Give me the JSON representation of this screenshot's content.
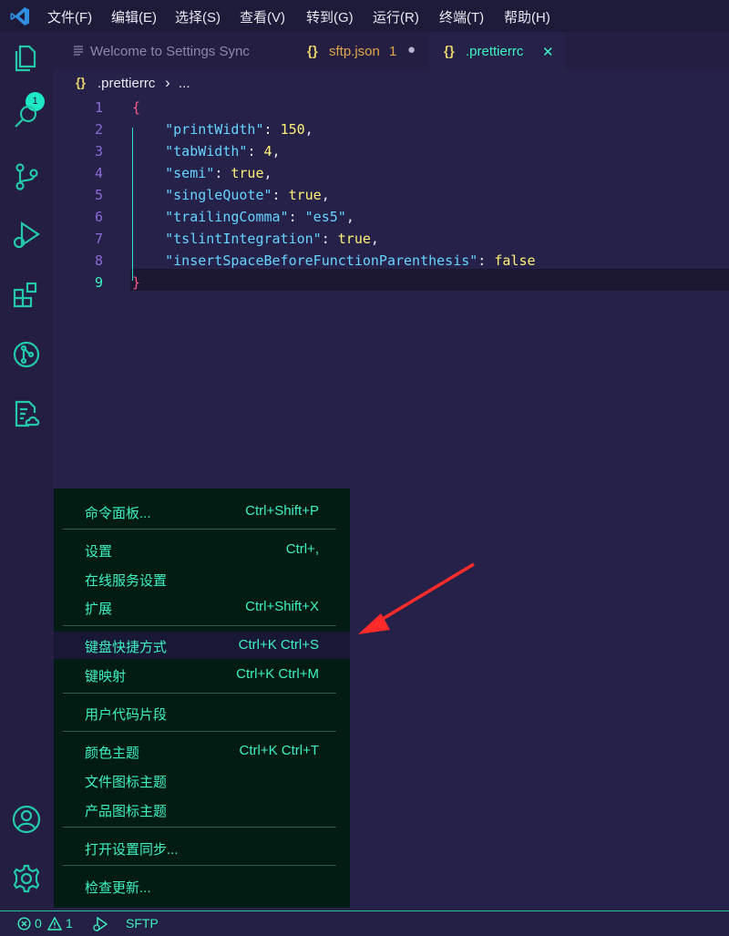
{
  "menubar": [
    "文件(F)",
    "编辑(E)",
    "选择(S)",
    "查看(V)",
    "转到(G)",
    "运行(R)",
    "终端(T)",
    "帮助(H)"
  ],
  "activity_bar": {
    "items": [
      "files-icon",
      "search-icon",
      "source-control-icon",
      "run-debug-icon",
      "extensions-icon",
      "git-graph-icon",
      "settings-sync-icon"
    ],
    "badge": "1",
    "bottom": [
      "account-icon",
      "manage-gear-icon"
    ]
  },
  "tabs": [
    {
      "label": "Welcome to Settings Sync",
      "icon": "preview-icon"
    },
    {
      "label": "sftp.json",
      "icon": "{}",
      "problems": "1",
      "modified": "●"
    },
    {
      "label": ".prettierrc",
      "icon": "{}",
      "close": "✕",
      "active": true
    }
  ],
  "breadcrumb": {
    "icon": "{}",
    "file": ".prettierrc",
    "sep": "›",
    "more": "..."
  },
  "editor": {
    "lines": [
      {
        "num": "1",
        "text": "{"
      },
      {
        "num": "2",
        "key": "\"printWidth\"",
        "value": "150",
        "vtype": "n",
        "comma": ","
      },
      {
        "num": "3",
        "key": "\"tabWidth\"",
        "value": "4",
        "vtype": "n",
        "comma": ","
      },
      {
        "num": "4",
        "key": "\"semi\"",
        "value": "true",
        "vtype": "n",
        "comma": ","
      },
      {
        "num": "5",
        "key": "\"singleQuote\"",
        "value": "true",
        "vtype": "n",
        "comma": ","
      },
      {
        "num": "6",
        "key": "\"trailingComma\"",
        "value": "\"es5\"",
        "vtype": "s",
        "comma": ","
      },
      {
        "num": "7",
        "key": "\"tslintIntegration\"",
        "value": "true",
        "vtype": "n",
        "comma": ","
      },
      {
        "num": "8",
        "key": "\"insertSpaceBeforeFunctionParenthesis\"",
        "value": "false",
        "vtype": "n",
        "comma": ""
      },
      {
        "num": "9",
        "text": "}"
      }
    ]
  },
  "context_menu": {
    "items": [
      {
        "label": "命令面板...",
        "shortcut": "Ctrl+Shift+P"
      },
      {
        "label": "设置",
        "shortcut": "Ctrl+,"
      },
      {
        "label": "在线服务设置",
        "shortcut": ""
      },
      {
        "label": "扩展",
        "shortcut": "Ctrl+Shift+X"
      },
      {
        "label": "键盘快捷方式",
        "shortcut": "Ctrl+K Ctrl+S",
        "highlighted": true
      },
      {
        "label": "键映射",
        "shortcut": "Ctrl+K Ctrl+M"
      },
      {
        "label": "用户代码片段",
        "shortcut": ""
      },
      {
        "label": "颜色主题",
        "shortcut": "Ctrl+K Ctrl+T"
      },
      {
        "label": "文件图标主题",
        "shortcut": ""
      },
      {
        "label": "产品图标主题",
        "shortcut": ""
      },
      {
        "label": "打开设置同步...",
        "shortcut": ""
      },
      {
        "label": "检查更新...",
        "shortcut": ""
      }
    ]
  },
  "status_bar": {
    "errors": "0",
    "warnings": "1",
    "sftp": "SFTP"
  },
  "colors": {
    "accent": "#3ef2c0",
    "arrow": "#ff2a2a",
    "menu_bg": "#021c14"
  }
}
